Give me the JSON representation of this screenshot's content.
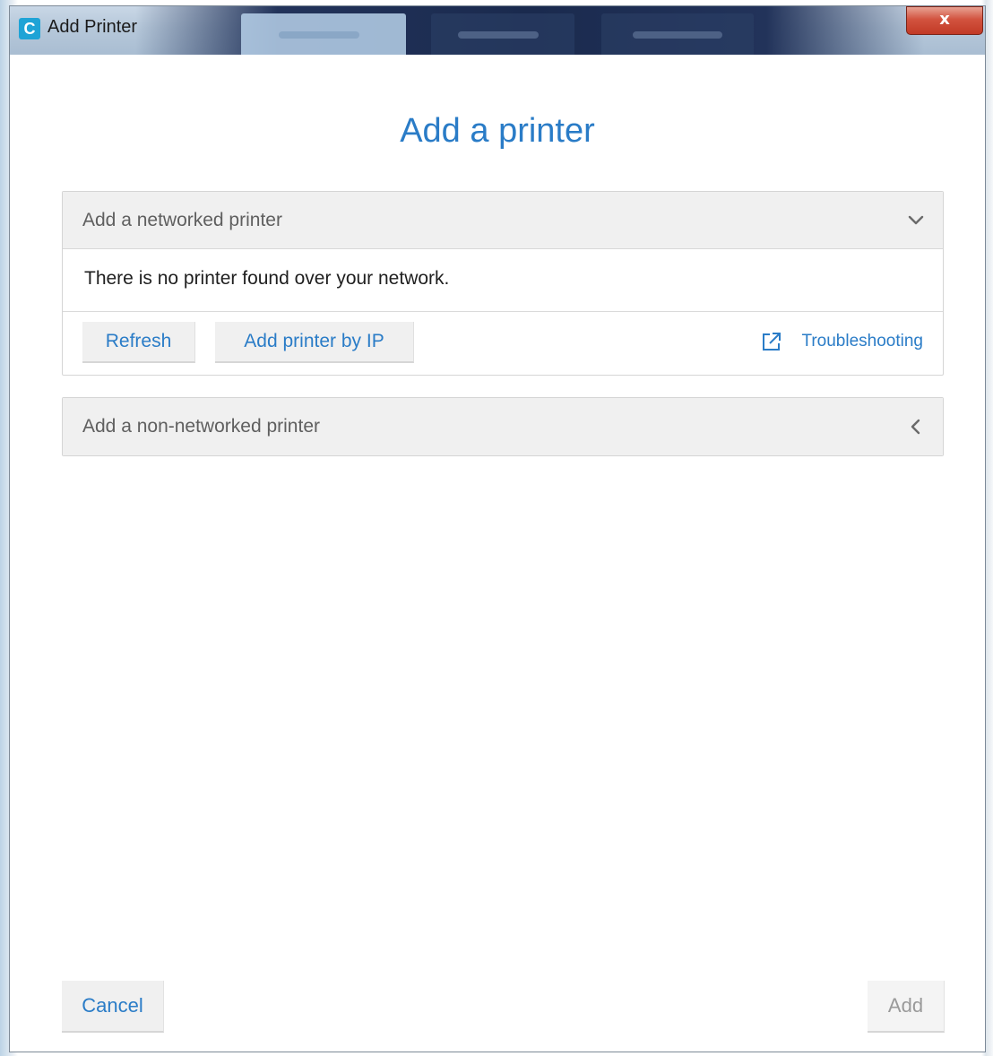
{
  "window": {
    "title": "Add Printer",
    "app_icon_letter": "C",
    "close_glyph": "x"
  },
  "heading": "Add a printer",
  "networked_panel": {
    "label": "Add a networked printer",
    "chevron": "chevron-down-icon",
    "message": "There is no printer found over your network.",
    "buttons": {
      "refresh": "Refresh",
      "add_by_ip": "Add printer by IP"
    },
    "troubleshooting": "Troubleshooting"
  },
  "non_networked_panel": {
    "label": "Add a non-networked printer",
    "chevron": "chevron-left-icon"
  },
  "footer": {
    "cancel": "Cancel",
    "add": "Add"
  },
  "colors": {
    "accent": "#2a7cc7",
    "panel_header_bg": "#f0f0f0",
    "disabled_text": "#9a9a9a",
    "close_button": "#c23a26",
    "app_icon": "#1fa3d6"
  }
}
